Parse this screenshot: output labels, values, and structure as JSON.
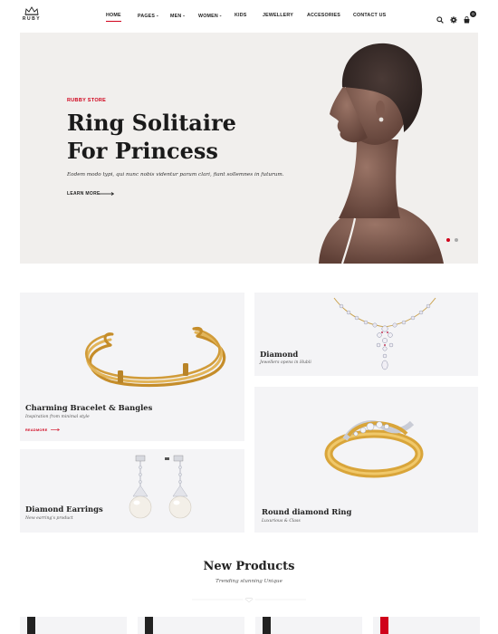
{
  "brand": {
    "name": "RUBY"
  },
  "nav": {
    "items": [
      {
        "label": "HOME",
        "active": true,
        "has_caret": false
      },
      {
        "label": "PAGES",
        "active": false,
        "has_caret": true
      },
      {
        "label": "MEN",
        "active": false,
        "has_caret": true
      },
      {
        "label": "WOMEN",
        "active": false,
        "has_caret": true
      },
      {
        "label": "KIDS",
        "active": false,
        "has_caret": false
      },
      {
        "label": "JEWELLERY",
        "active": false,
        "has_caret": false
      },
      {
        "label": "ACCESORIES",
        "active": false,
        "has_caret": false
      },
      {
        "label": "CONTACT US",
        "active": false,
        "has_caret": false
      }
    ],
    "icons": [
      "search-icon",
      "gear-icon",
      "cart-icon"
    ],
    "cart_count": "0"
  },
  "hero": {
    "eyebrow": "RUBBY STORE",
    "title_line1": "Ring Solitaire",
    "title_line2": "For Princess",
    "description": "Eodem modo typi, qui nunc nobis videntur parum clari, fiant sollemnes in futurum.",
    "link_label": "LEARN MORE",
    "slides": 2,
    "active_slide": 1
  },
  "tiles": {
    "bracelet": {
      "title": "Charming Bracelet & Bangles",
      "subtitle": "Inspiration from minimal style",
      "link": "READMORE"
    },
    "diamond": {
      "title": "Diamond",
      "subtitle": "Jewellers opens in Hubli"
    },
    "earrings": {
      "title": "Diamond Earrings",
      "subtitle": "New earring's product"
    },
    "ring": {
      "title": "Round diamond Ring",
      "subtitle": "Luxurious & Class"
    }
  },
  "new_products": {
    "title": "New Products",
    "subtitle": "Trending stunning Unique"
  },
  "colors": {
    "accent": "#d0021b",
    "hero_bg": "#f1efed",
    "tile_bg": "#f4f4f6",
    "text": "#222222",
    "gold": "#d9a53a"
  }
}
